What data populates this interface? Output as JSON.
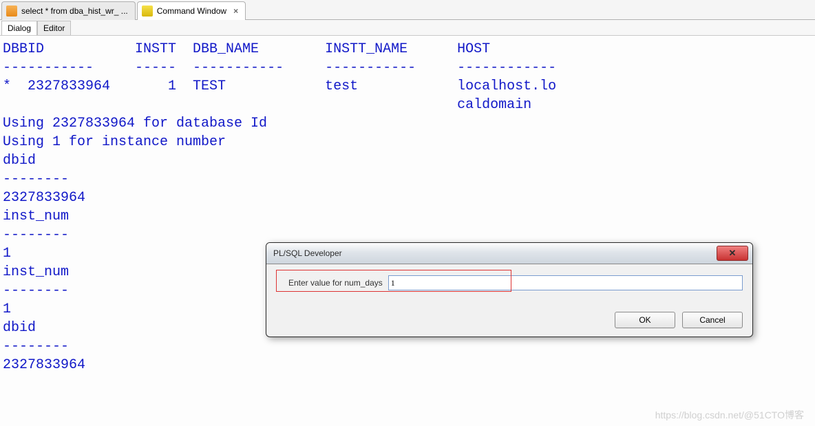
{
  "tabs": {
    "sql_tab": "select * from dba_hist_wr_ ...",
    "cmd_tab": "Command Window",
    "close_glyph": "×"
  },
  "subtabs": {
    "dialog": "Dialog",
    "editor": "Editor"
  },
  "terminal": "DBBID           INSTT  DBB_NAME        INSTT_NAME      HOST\n-----------     -----  -----------     -----------     ------------\n*  2327833964       1  TEST            test            localhost.lo\n                                                       caldomain\nUsing 2327833964 for database Id\nUsing 1 for instance number\ndbid\n--------\n2327833964\ninst_num\n--------\n1\ninst_num\n--------\n1\ndbid\n--------\n2327833964",
  "dialog": {
    "title": "PL/SQL Developer",
    "prompt": "Enter value for num_days",
    "value": "1",
    "ok": "OK",
    "cancel": "Cancel",
    "close": "✕"
  },
  "watermark": "https://blog.csdn.net/@51CTO博客"
}
